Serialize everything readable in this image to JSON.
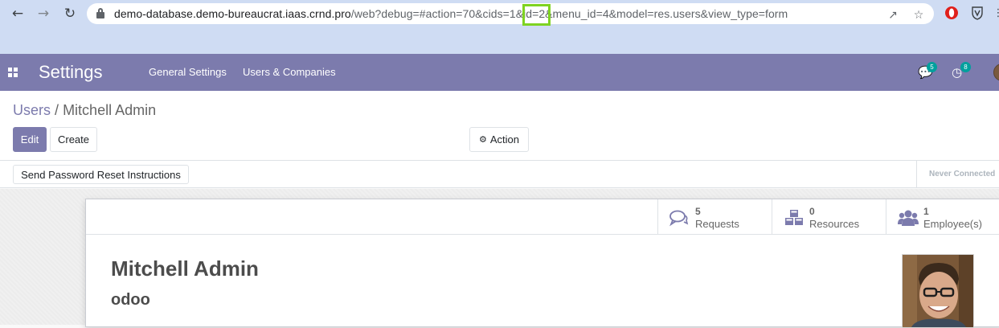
{
  "browser": {
    "url_host": "demo-database.demo-bureaucrat.iaas.crnd.pro",
    "url_path": "/web?debug=#action=70&cids=1&id=2&menu_id=4&model=res.users&view_type=form",
    "icons": [
      "back-arrow",
      "forward-arrow",
      "reload",
      "lock",
      "share",
      "bookmark-star",
      "opera-extension",
      "vivaldi-extension",
      "more-menu"
    ]
  },
  "topnav": {
    "app_title": "Settings",
    "menu": [
      "General Settings",
      "Users & Companies"
    ],
    "messages_count": "5",
    "activities_count": "8"
  },
  "control_panel": {
    "breadcrumb_parent": "Users",
    "breadcrumb_separator": "/",
    "breadcrumb_current": "Mitchell Admin",
    "edit_label": "Edit",
    "create_label": "Create",
    "action_label": "Action"
  },
  "statusbar": {
    "reset_button": "Send Password Reset Instructions",
    "status": "Never Connected"
  },
  "stat_buttons": [
    {
      "value": "5",
      "label": "Requests",
      "icon": "comments-icon"
    },
    {
      "value": "0",
      "label": "Resources",
      "icon": "cubes-icon"
    },
    {
      "value": "1",
      "label": "Employee(s)",
      "icon": "users-icon"
    }
  ],
  "form": {
    "name": "Mitchell Admin",
    "login": "odoo"
  },
  "colors": {
    "brand": "#7c7bad",
    "badge": "#00a09d",
    "highlight": "#7ed321"
  }
}
